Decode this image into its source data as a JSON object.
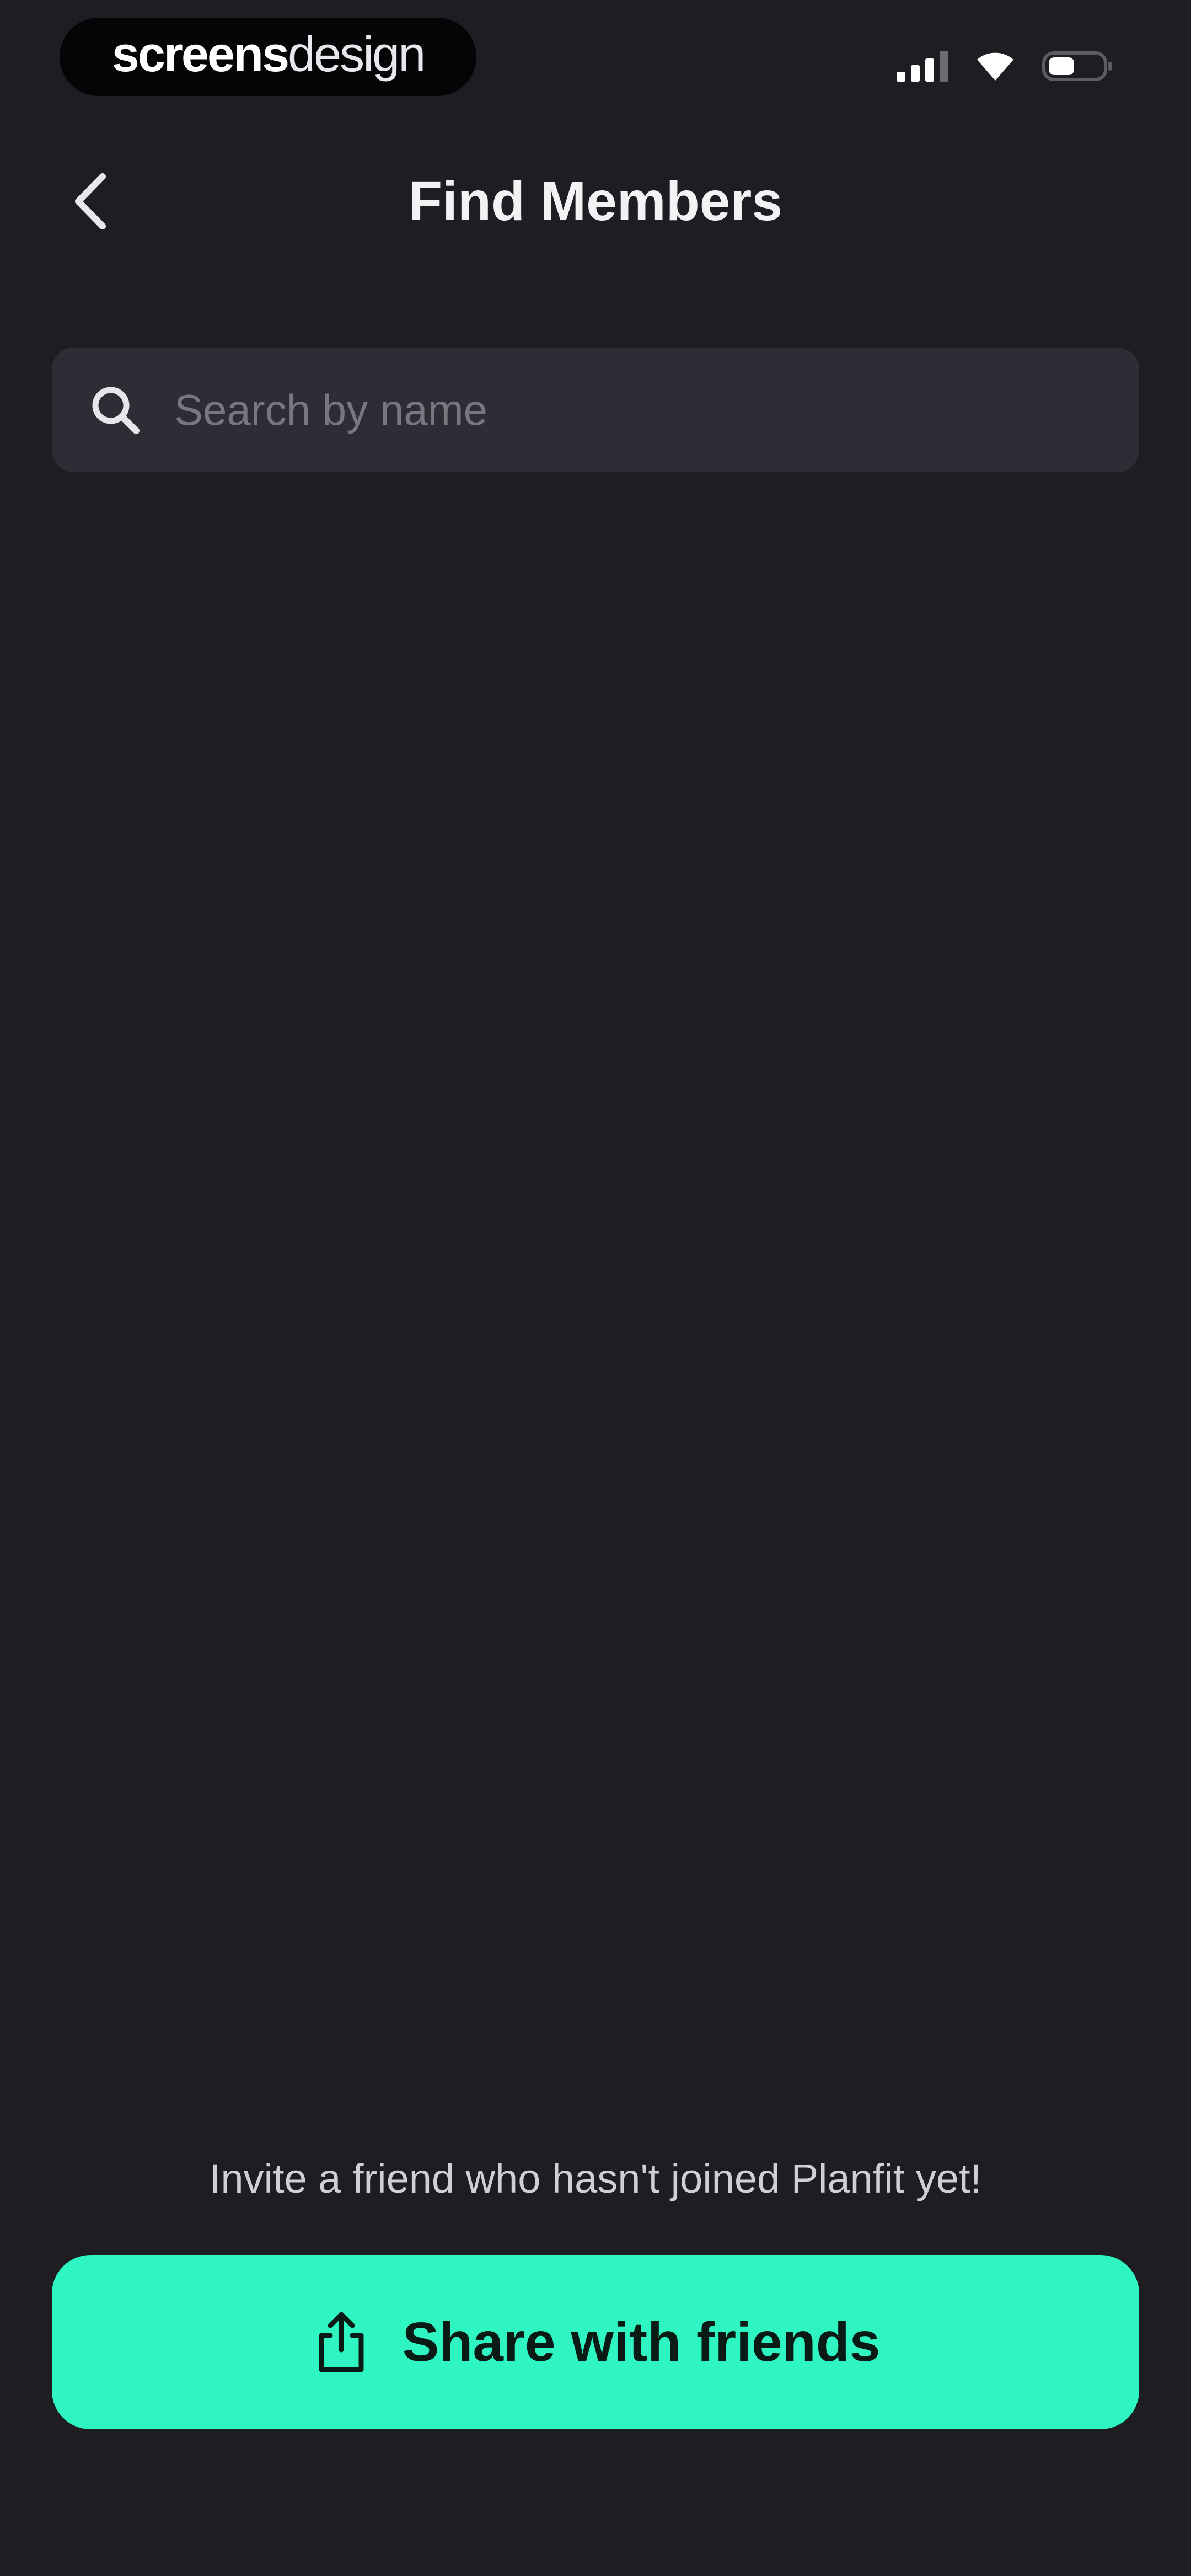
{
  "status_bar": {
    "brand_bold": "screens",
    "brand_light": "design",
    "icons": [
      "signal-icon",
      "wifi-icon",
      "battery-icon"
    ]
  },
  "header": {
    "back_icon": "chevron-left-icon",
    "title": "Find Members"
  },
  "search": {
    "icon": "search-icon",
    "placeholder": "Search by name",
    "value": ""
  },
  "footer": {
    "invite_text": "Invite a friend who hasn't joined Planfit yet!",
    "share_icon": "share-icon",
    "share_label": "Share with friends"
  },
  "colors": {
    "background": "#1d1d22",
    "search_field": "#2d2e35",
    "accent": "#2ef5c2",
    "text_primary": "#f2f2f5"
  }
}
